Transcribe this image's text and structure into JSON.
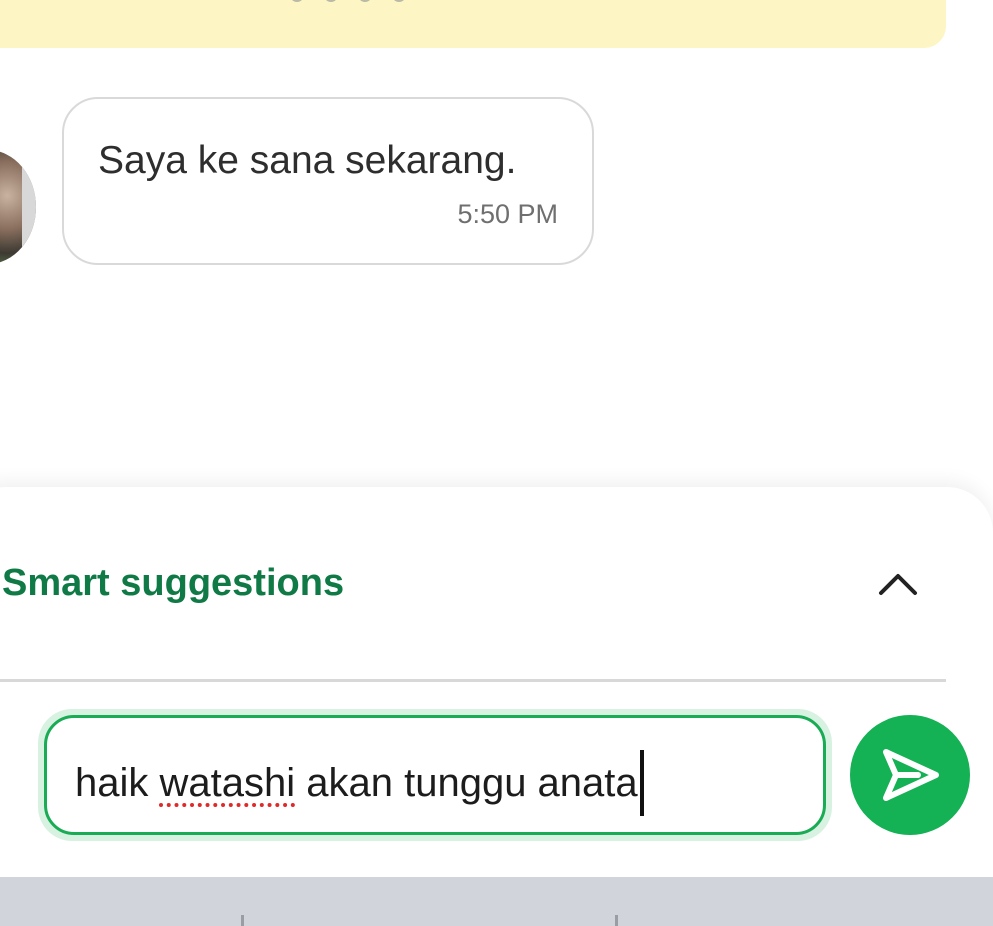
{
  "banner": {
    "color": "#fdf5c4"
  },
  "message": {
    "text": "Saya ke sana sekarang.",
    "time": "5:50 PM"
  },
  "suggestions": {
    "title": "Smart suggestions",
    "expanded": true,
    "toggle_icon": "chevron-up-icon"
  },
  "composer": {
    "value_start": "haik ",
    "misspelled_word": "watashi",
    "value_end": " akan tunggu anata",
    "send_icon": "send-icon"
  },
  "colors": {
    "accent": "#14b155",
    "title_green": "#0f7a45",
    "spellcheck": "#e02a2a"
  }
}
